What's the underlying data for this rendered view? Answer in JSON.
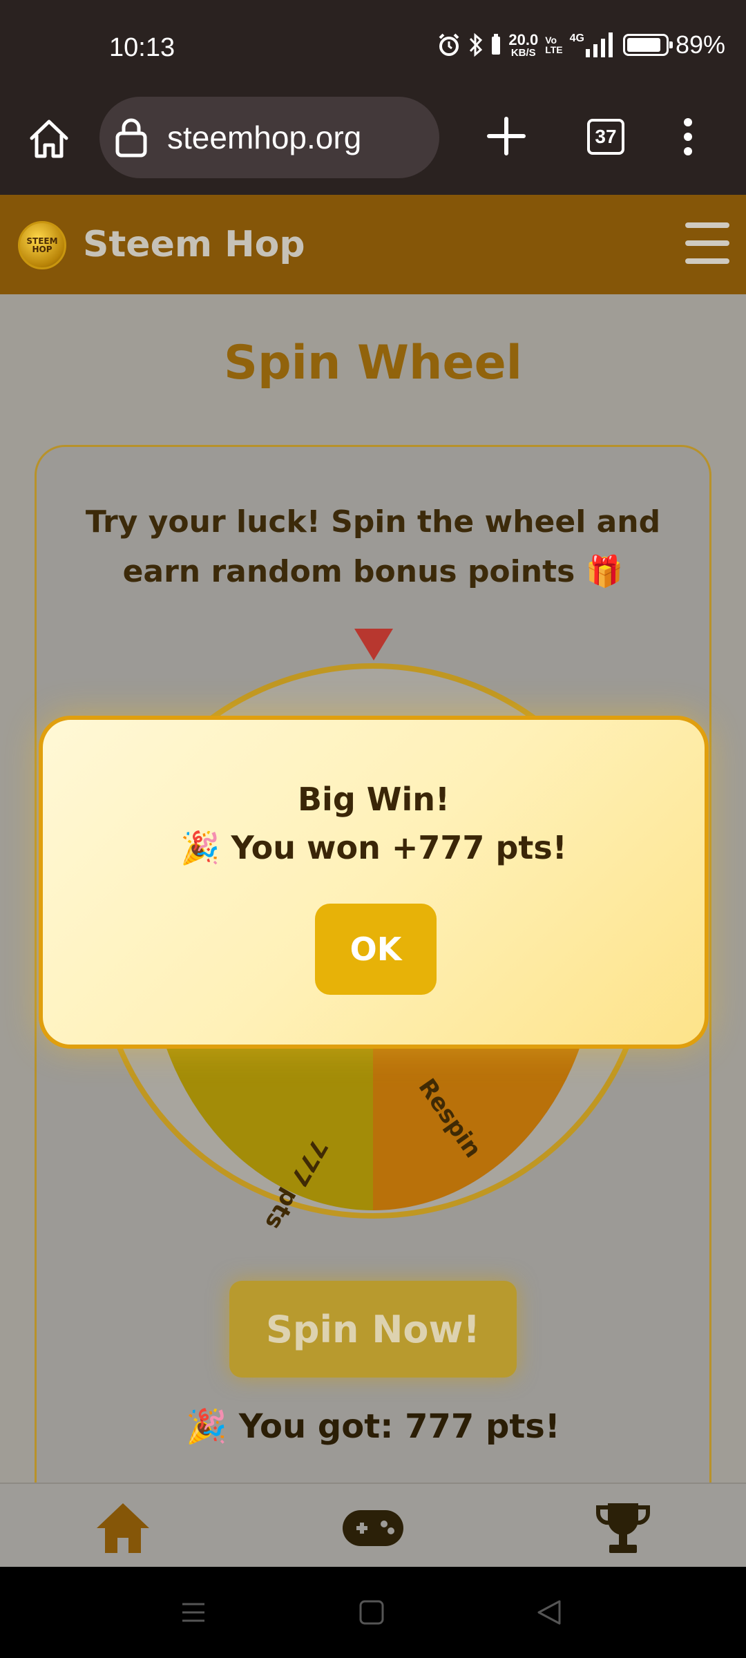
{
  "status_bar": {
    "time": "10:13",
    "net_speed_value": "20.0",
    "net_speed_unit": "KB/S",
    "volte_top": "Vo",
    "volte_bottom": "LTE",
    "network": "4G",
    "battery_percent": "89%",
    "battery_level": 0.89,
    "icons": [
      "alarm-icon",
      "bluetooth-icon",
      "signal-icon",
      "battery-icon"
    ]
  },
  "browser": {
    "url": "steemhop.org",
    "tab_count": "37",
    "icons": [
      "home-icon",
      "lock-icon",
      "plus-icon",
      "more-vert-icon"
    ]
  },
  "site": {
    "logo_top": "STEEM",
    "logo_bottom": "HOP",
    "title": "Steem Hop"
  },
  "main": {
    "page_title": "Spin Wheel",
    "description": "Try your luck! Spin the wheel and earn random bonus points 🎁",
    "wheel_labels": [
      "777 pts",
      "Respin"
    ],
    "spin_button": "Spin Now!",
    "result": "🎉 You got: 777 pts!"
  },
  "modal": {
    "title": "Big Win!",
    "message": "🎉 You won +777 pts!",
    "ok_label": "OK"
  },
  "bottom_nav": {
    "items": [
      "home-icon",
      "gamepad-icon",
      "trophy-icon"
    ]
  },
  "android_nav": {
    "items": [
      "menu-icon",
      "square-icon",
      "back-icon"
    ]
  },
  "colors": {
    "header": "#855608",
    "accent": "#e7b208",
    "modal_border": "#e09f0e"
  }
}
